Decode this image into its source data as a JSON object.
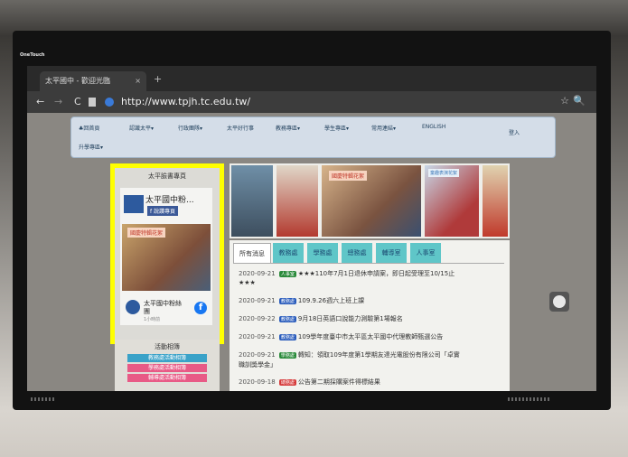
{
  "tv": {
    "brand": "OneTouch"
  },
  "browser": {
    "tab_title": "太平國中 - 歡迎光臨",
    "tab_close": "×",
    "new_tab": "+",
    "back": "←",
    "forward": "→",
    "reload": "C",
    "url": "http://www.tpjh.tc.edu.tw/",
    "star": "☆",
    "zoom": "🔍"
  },
  "menu": {
    "items": [
      "♣回首頁",
      "認識太平▾",
      "行政團隊▾",
      "太平好行事",
      "教務專區▾",
      "學生專區▾",
      "常用連結▾",
      "ENGLISH",
      "升學專區▾"
    ],
    "login": "登入"
  },
  "sidebar": {
    "title": "太平臉書專頁",
    "fb_name": "太平國中粉...",
    "fb_like": "f 說讚專頁",
    "fb_banner": "國慶特輯花絮",
    "footer_name": "太平國中粉絲團",
    "footer_sub": "1小時前",
    "fb_icon": "f"
  },
  "activity": {
    "title": "活動相簿",
    "items": [
      "教務處活動相簿",
      "學務處活動相簿",
      "輔導處活動相簿"
    ],
    "colors": [
      "#3aa2c8",
      "#e85a86",
      "#e85a86"
    ]
  },
  "news": {
    "tabs": [
      "所有消息",
      "教務處",
      "學務處",
      "總務處",
      "輔導室",
      "人事室"
    ],
    "items": [
      {
        "date": "2020-09-21",
        "tag": "人事室",
        "tag_color": "#2a8a3a",
        "text": "★★★110年7月1日退休申請案，即日起受理至10/15止",
        "text2": "★★★"
      },
      {
        "date": "2020-09-21",
        "tag": "教務處",
        "tag_color": "#2a5cbc",
        "text": "109.9.26週六上班上課",
        "text2": ""
      },
      {
        "date": "2020-09-22",
        "tag": "教務處",
        "tag_color": "#2a5cbc",
        "text": "9月18日英語口說能力測驗第1場報名",
        "text2": ""
      },
      {
        "date": "2020-09-21",
        "tag": "教務處",
        "tag_color": "#2a5cbc",
        "text": "109學年度臺中市太平區太平國中代理教師甄選公告",
        "text2": ""
      },
      {
        "date": "2020-09-21",
        "tag": "學務處",
        "tag_color": "#2a8a3a",
        "text": "轉知：領取109年度第1學期友達光電股份有限公司「卓實",
        "text2": "職訓獎學金」"
      },
      {
        "date": "2020-09-18",
        "tag": "總務處",
        "tag_color": "#d63a3a",
        "text": "公告第二期採購案件得標結果",
        "text2": ""
      }
    ]
  },
  "photos": {
    "banner1": "國慶特輯花絮",
    "banner2": "童趣表演花絮"
  }
}
